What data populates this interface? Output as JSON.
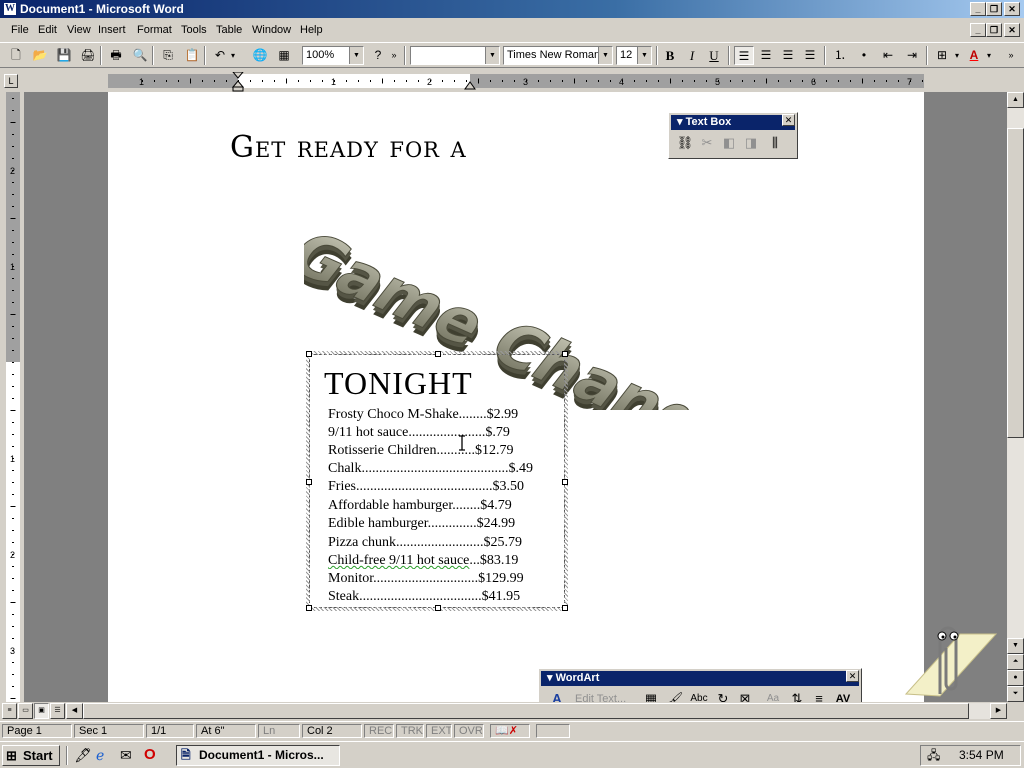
{
  "window": {
    "title": "Document1 - Microsoft Word"
  },
  "menu": {
    "items": [
      "File",
      "Edit",
      "View",
      "Insert",
      "Format",
      "Tools",
      "Table",
      "Window",
      "Help"
    ]
  },
  "toolbar": {
    "zoom": "100%",
    "style": "",
    "font": "Times New Roman",
    "size": "12"
  },
  "document": {
    "headline": "Get ready for a",
    "wordart": "Game Changer!",
    "menu_title": "TONIGHT",
    "menu_items": [
      {
        "name": "Frosty Choco M-Shake",
        "dots": "........",
        "price": "$2.99"
      },
      {
        "name": "9/11 hot sauce",
        "dots": "......................",
        "price": "$.79"
      },
      {
        "name": "Rotisserie Children",
        "dots": "...........",
        "price": "$12.79"
      },
      {
        "name": "Chalk",
        "dots": "..........................................",
        "price": "$.49"
      },
      {
        "name": "Fries",
        "dots": ".......................................",
        "price": "$3.50"
      },
      {
        "name": "Affordable hamburger",
        "dots": "........",
        "price": "$4.79"
      },
      {
        "name": "Edible hamburger",
        "dots": "..............",
        "price": "$24.99"
      },
      {
        "name": "Pizza chunk",
        "dots": ".........................",
        "price": "$25.79"
      },
      {
        "name": "Child-free 9/11 hot sauce",
        "dots": "...",
        "price": "$83.19"
      },
      {
        "name": "Monitor",
        "dots": "..............................",
        "price": "$129.99"
      },
      {
        "name": "Steak",
        "dots": "...................................",
        "price": "$41.95"
      }
    ]
  },
  "textbox_toolbar": {
    "title": "Text Box"
  },
  "wordart_toolbar": {
    "title": "WordArt",
    "edit_text": "Edit Text..."
  },
  "status": {
    "page": "Page 1",
    "sec": "Sec 1",
    "pages": "1/1",
    "at": "At 6\"",
    "ln": "Ln",
    "col": "Col 2",
    "rec": "REC",
    "trk": "TRK",
    "ext": "EXT",
    "ovr": "OVR"
  },
  "taskbar": {
    "start": "Start",
    "task": "Document1 - Micros...",
    "clock": "3:54 PM"
  }
}
